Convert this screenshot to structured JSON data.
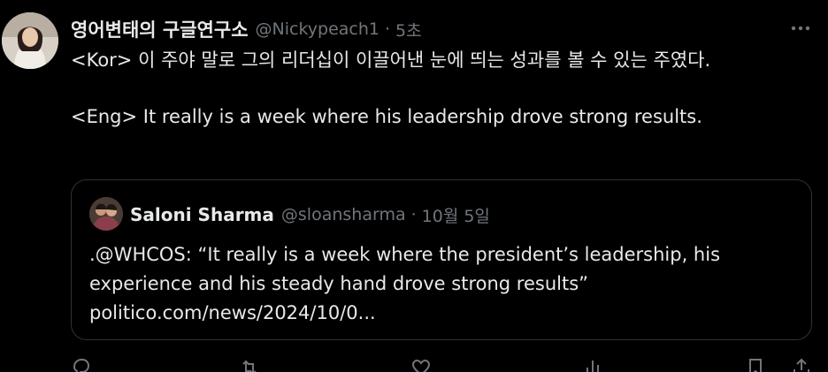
{
  "tweet": {
    "display_name": "영어변태의 구글연구소",
    "handle": "@Nickypeach1",
    "separator": "·",
    "time": "5초",
    "body": {
      "line_kor": "<Kor> 이 주야 말로 그의 리더십이 이끌어낸 눈에 띄는 성과를 볼 수 있는 주였다.",
      "line_eng": "<Eng> It really is a week where his leadership drove strong results."
    },
    "more_icon": "more-dots-icon"
  },
  "quote": {
    "display_name": "Saloni Sharma",
    "handle": "@sloansharma",
    "separator": "·",
    "time": "10월 5일",
    "text_line1": ".@WHCOS: “It really is a week where the president’s leadership, his experience and his steady hand drove strong results”",
    "link": "politico.com/news/2024/10/0..."
  },
  "actions": {
    "icons": [
      "reply-icon",
      "retweet-icon",
      "like-icon",
      "views-icon",
      "bookmark-icon",
      "share-icon"
    ]
  },
  "colors": {
    "background": "#000000",
    "text": "#e7e9ea",
    "muted": "#71767b",
    "border": "#2f3336"
  }
}
